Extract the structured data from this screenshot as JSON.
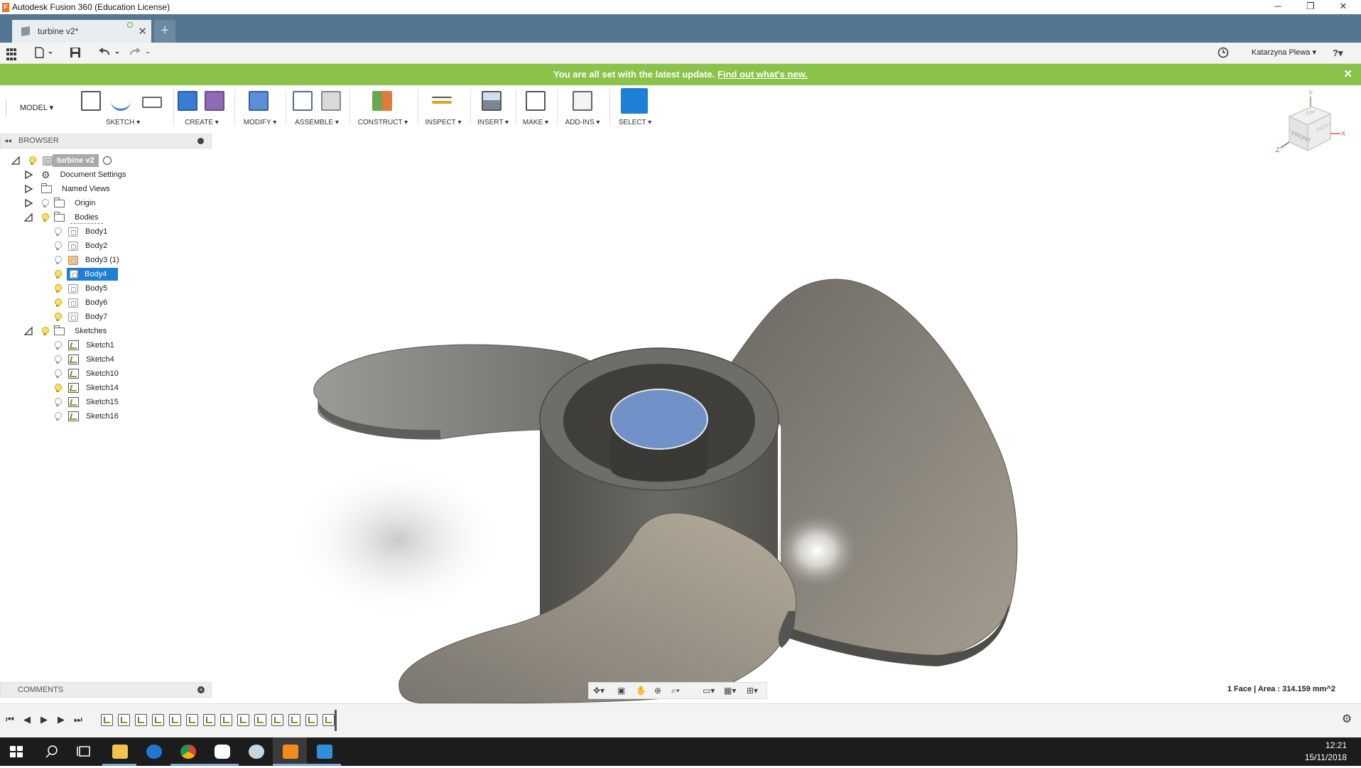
{
  "window": {
    "title": "Autodesk Fusion 360 (Education License)",
    "controls": [
      "─",
      "❐",
      "✕"
    ]
  },
  "tabs": {
    "doc_title": "turbine v2*",
    "close": "✕",
    "new_tab": "+"
  },
  "quick_access": {
    "user": "Katarzyna Plewa ▾",
    "help": "?▾"
  },
  "banner": {
    "message": "You are all set with the latest update.",
    "link": "Find out what's new.",
    "close": "✕"
  },
  "toolbar": {
    "workspace": "MODEL ▾",
    "groups": [
      {
        "label": "SKETCH ▾"
      },
      {
        "label": "CREATE ▾"
      },
      {
        "label": "MODIFY ▾"
      },
      {
        "label": "ASSEMBLE ▾"
      },
      {
        "label": "CONSTRUCT ▾"
      },
      {
        "label": "INSPECT ▾"
      },
      {
        "label": "INSERT ▾"
      },
      {
        "label": "MAKE ▾"
      },
      {
        "label": "ADD-INS ▾"
      },
      {
        "label": "SELECT ▾"
      }
    ],
    "colors": {
      "select_active": "#1d7fd6"
    }
  },
  "browser": {
    "header": "BROWSER",
    "root": "turbine v2",
    "items": {
      "document_settings": "Document Settings",
      "named_views": "Named Views",
      "origin": "Origin",
      "bodies": "Bodies",
      "sketches": "Sketches"
    },
    "bodies": [
      "Body1",
      "Body2",
      "Body3 (1)",
      "Body4",
      "Body5",
      "Body6",
      "Body7"
    ],
    "sketches": [
      "Sketch1",
      "Sketch4",
      "Sketch10",
      "Sketch14",
      "Sketch15",
      "Sketch16"
    ],
    "selected_body": "Body4"
  },
  "viewcube": {
    "top": "TOP",
    "front": "FRONT",
    "right": "RIGHT",
    "axes": {
      "y": "Y",
      "x": "X",
      "z": "Z"
    }
  },
  "comments": {
    "header": "COMMENTS"
  },
  "status": {
    "selection": "1 Face | Area : 314.159 mm^2"
  },
  "taskbar": {
    "time": "12:21",
    "date": "15/11/2018"
  }
}
